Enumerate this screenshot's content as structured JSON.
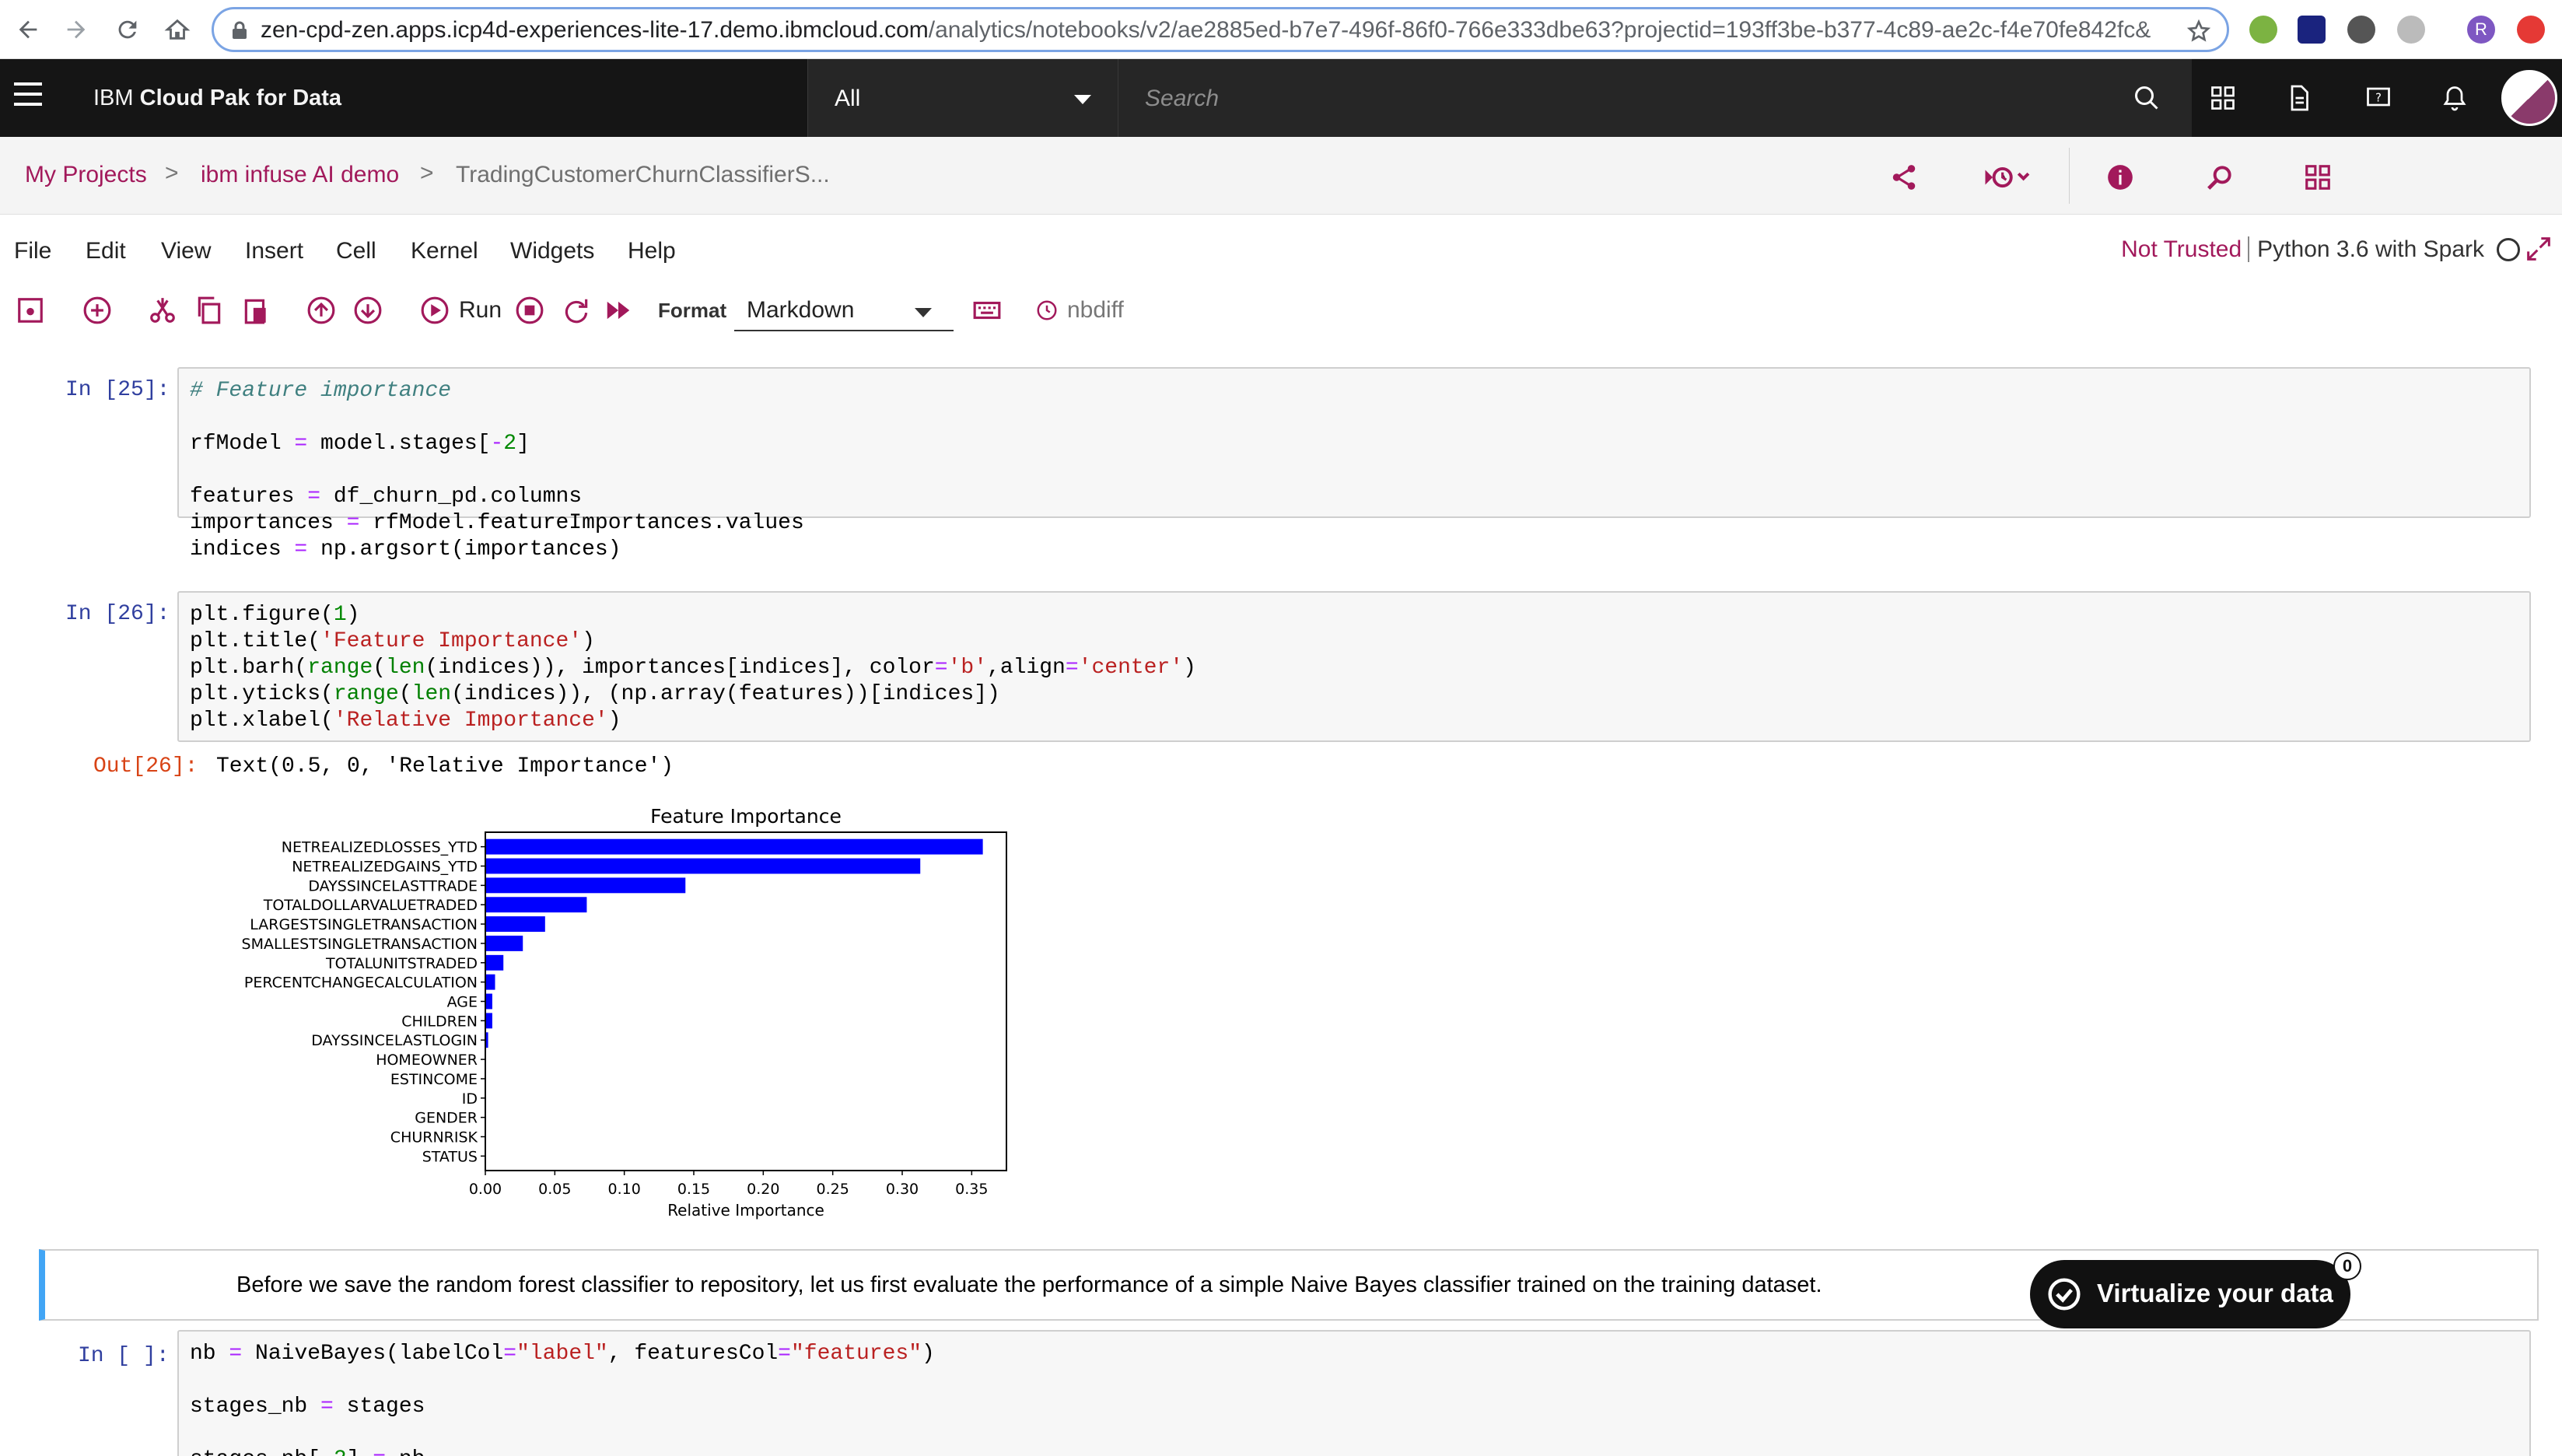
{
  "browser": {
    "url_host": "zen-cpd-zen.apps.icp4d-experiences-lite-17.demo.ibmcloud.com",
    "url_rest": "/analytics/notebooks/v2/ae2885ed-b7e7-496f-86f0-766e333dbe63?projectid=193ff3be-b377-4c89-ae2c-f4e70fe842fc&co...",
    "profile_initial": "R"
  },
  "header": {
    "brand_prefix": "IBM ",
    "brand_name": "Cloud Pak for Data",
    "scope_value": "All",
    "search_placeholder": "Search"
  },
  "breadcrumb": {
    "items": [
      "My Projects",
      "ibm infuse AI demo",
      "TradingCustomerChurnClassifierS..."
    ],
    "separator": ">"
  },
  "menu": {
    "items": [
      "File",
      "Edit",
      "View",
      "Insert",
      "Cell",
      "Kernel",
      "Widgets",
      "Help"
    ],
    "trust_status": "Not Trusted",
    "kernel_name": "Python 3.6 with Spark"
  },
  "toolbar": {
    "run_label": "Run",
    "format_label": "Format",
    "format_value": "Markdown",
    "nbdiff_label": "nbdiff"
  },
  "cells": {
    "c25_prompt": "In [25]:",
    "c26_prompt": "In [26]:",
    "c26_out_prompt": "Out[26]:",
    "c26_out_text": "Text(0.5, 0, 'Relative Importance')",
    "markdown_text": "Before we save the random forest classifier to repository, let us first evaluate the performance of a simple Naive Bayes classifier trained on the training dataset.",
    "c_nb_prompt": "In [ ]:"
  },
  "virtualize": {
    "label": "Virtualize your data",
    "badge": "0"
  },
  "colors": {
    "brand_magenta": "#a2195b",
    "header_bg": "#151515",
    "bar_color": "#0000ff",
    "md_accent": "#42a5f5"
  },
  "chart_data": {
    "type": "bar",
    "orientation": "horizontal",
    "title": "Feature Importance",
    "xlabel": "Relative Importance",
    "ylabel": "",
    "xlim": [
      0,
      0.375
    ],
    "xticks": [
      "0.00",
      "0.05",
      "0.10",
      "0.15",
      "0.20",
      "0.25",
      "0.30",
      "0.35"
    ],
    "categories": [
      "NETREALIZEDLOSSES_YTD",
      "NETREALIZEDGAINS_YTD",
      "DAYSSINCELASTTRADE",
      "TOTALDOLLARVALUETRADED",
      "LARGESTSINGLETRANSACTION",
      "SMALLESTSINGLETRANSACTION",
      "TOTALUNITSTRADED",
      "PERCENTCHANGECALCULATION",
      "AGE",
      "CHILDREN",
      "DAYSSINCELASTLOGIN",
      "HOMEOWNER",
      "ESTINCOME",
      "ID",
      "GENDER",
      "CHURNRISK",
      "STATUS"
    ],
    "values": [
      0.358,
      0.313,
      0.144,
      0.073,
      0.043,
      0.027,
      0.013,
      0.007,
      0.005,
      0.005,
      0.002,
      0.0,
      0.0,
      0.0,
      0.0,
      0.0,
      0.0
    ],
    "grid": false
  }
}
